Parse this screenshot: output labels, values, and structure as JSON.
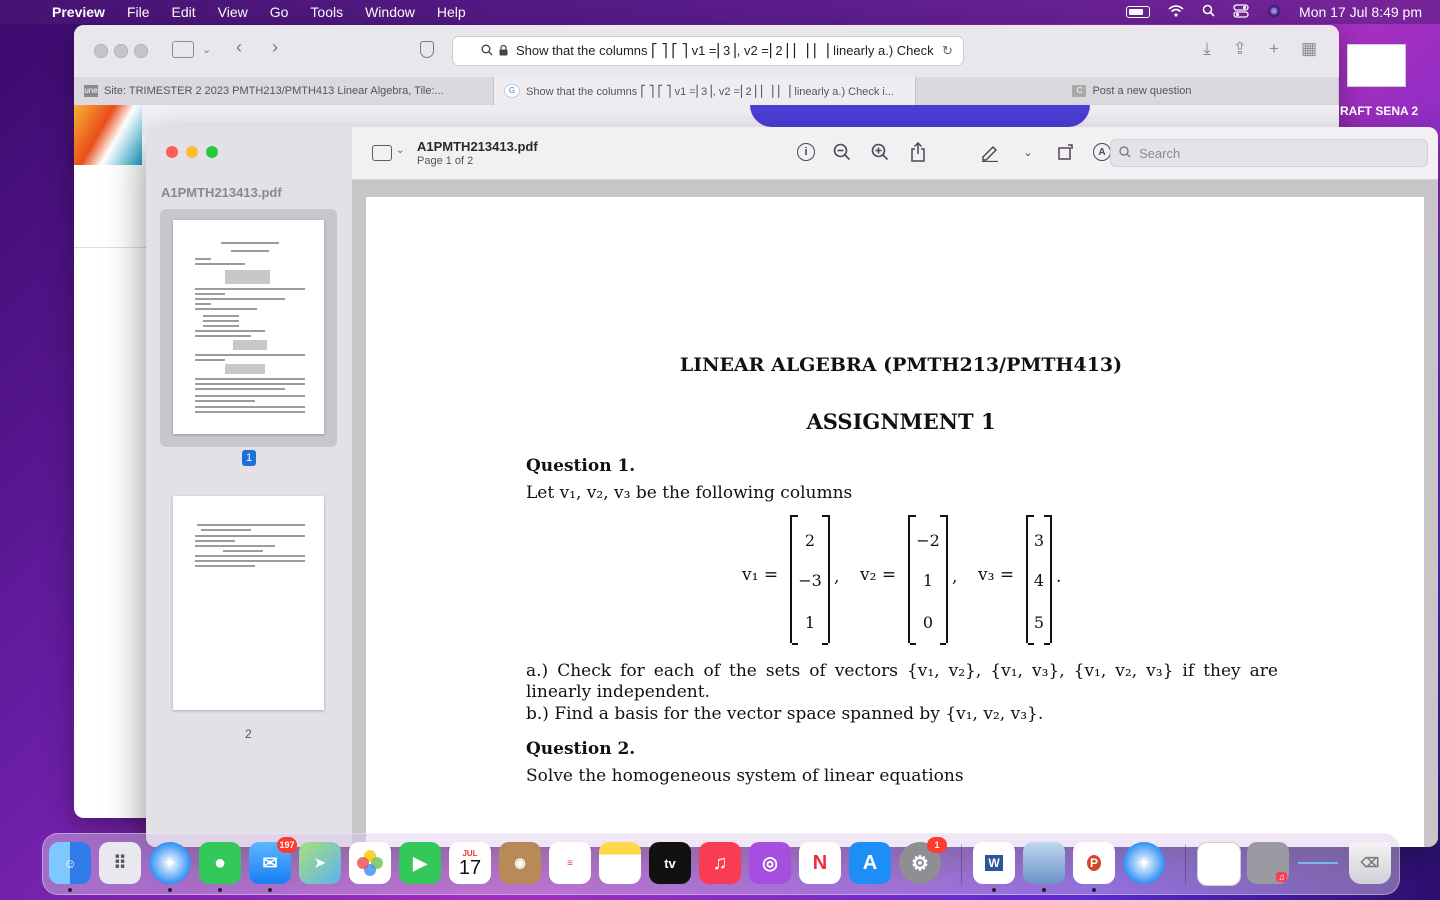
{
  "menubar": {
    "app": "Preview",
    "items": [
      "File",
      "Edit",
      "View",
      "Go",
      "Tools",
      "Window",
      "Help"
    ],
    "clock": "Mon 17 Jul  8:49 pm"
  },
  "safari": {
    "url_text": "Show that the columns ⎡ ⎤ ⎡ ⎤ v1 =⎢3⎥, v2 =⎢2⎥ ⎢ ⎥ ⎢ ⎥ linearly a.) Check in",
    "tabs": [
      {
        "favicon": "une",
        "label": "Site: TRIMESTER 2 2023 PMTH213/PMTH413 Linear Algebra, Tile:..."
      },
      {
        "favicon": "G",
        "label": "Show that the columns ⎡ ⎤ ⎡ ⎤ v1 =⎢3⎥, v2 =⎢2⎥ ⎢ ⎥ ⎢ ⎥ linearly a.) Check i..."
      },
      {
        "favicon": "C",
        "label": "Post a new question"
      }
    ],
    "side_label": "RAFT SENA 2"
  },
  "preview": {
    "sidebar_title": "A1PMTH213413.pdf",
    "page1_badge": "1",
    "page2_label": "2",
    "file_title": "A1PMTH213413.pdf",
    "page_info": "Page 1 of 2",
    "search_placeholder": "Search"
  },
  "document": {
    "title": "LINEAR ALGEBRA (PMTH213/PMTH413)",
    "assignment": "ASSIGNMENT 1",
    "q1_heading": "Question 1.",
    "q1_intro": "Let v₁, v₂, v₃ be the following columns",
    "vectors": [
      {
        "label": "v₁ =",
        "entries": [
          "2",
          "−3",
          "1"
        ]
      },
      {
        "label": "v₂ =",
        "entries": [
          "−2",
          "1",
          "0"
        ]
      },
      {
        "label": "v₃ =",
        "entries": [
          "3",
          "4",
          "5"
        ]
      }
    ],
    "part_a": "a.)  Check for each of the sets of vectors {v₁, v₂}, {v₁, v₃}, {v₁, v₂, v₃} if they are linearly independent.",
    "part_b": "b.)  Find a basis for the vector space spanned by {v₁, v₂, v₃}.",
    "q2_heading": "Question 2.",
    "q2_intro": "Solve the homogeneous system of linear equations"
  },
  "dock": {
    "apps": [
      "Finder",
      "Launchpad",
      "Safari",
      "Messages",
      "Mail",
      "Maps",
      "Photos",
      "FaceTime",
      "Calendar",
      "Contacts",
      "Reminders",
      "Notes",
      "TV",
      "Music",
      "Podcasts",
      "News",
      "App Store",
      "System Settings",
      "Word",
      "Preview",
      "PowerPoint",
      "Safari",
      "Documents",
      "Music Folder",
      "Downloads",
      "Trash"
    ],
    "mail_badge": "197",
    "settings_badge": "1",
    "calendar_month": "JUL",
    "calendar_day": "17",
    "tv_label": "tv"
  }
}
